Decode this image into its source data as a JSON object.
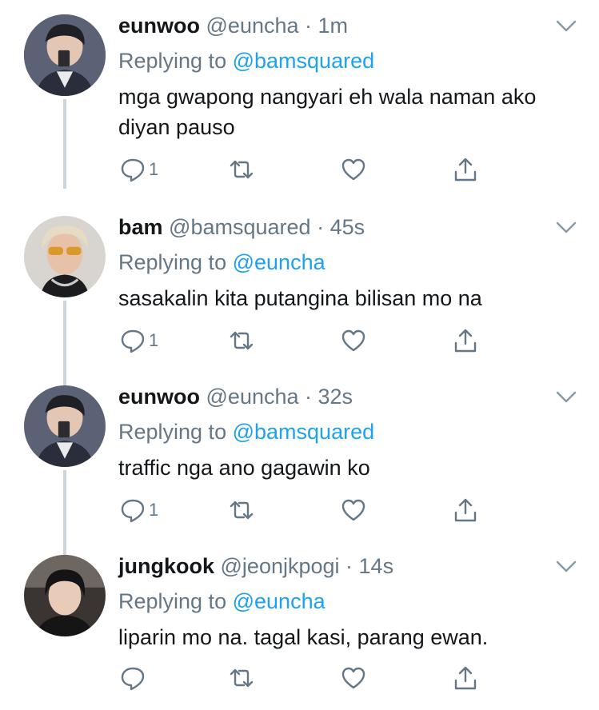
{
  "tweets": [
    {
      "name": "eunwoo",
      "handle": "@euncha",
      "time": "1m",
      "replying_prefix": "Replying to",
      "replying_to": "@bamsquared",
      "text": "mga gwapong nangyari eh wala naman ako diyan pauso",
      "reply_count": "1",
      "avatar": "avatar-mirror-selfie"
    },
    {
      "name": "bam",
      "handle": "@bamsquared",
      "time": "45s",
      "replying_prefix": "Replying to",
      "replying_to": "@euncha",
      "text": "sasakalin kita putangina bilisan mo na",
      "reply_count": "1",
      "avatar": "avatar-blond-sunglasses"
    },
    {
      "name": "eunwoo",
      "handle": "@euncha",
      "time": "32s",
      "replying_prefix": "Replying to",
      "replying_to": "@bamsquared",
      "text": "traffic nga ano gagawin ko",
      "reply_count": "1",
      "avatar": "avatar-mirror-selfie"
    },
    {
      "name": "jungkook",
      "handle": "@jeonjkpogi",
      "time": "14s",
      "replying_prefix": "Replying to",
      "replying_to": "@euncha",
      "text": "liparin mo na. tagal kasi, parang ewan.",
      "reply_count": "",
      "avatar": "avatar-dark-hair"
    }
  ],
  "colors": {
    "text": "#14171a",
    "secondary": "#657786",
    "link": "#1da1f2",
    "connector": "#ccd6dd"
  },
  "icons": [
    "reply-icon",
    "retweet-icon",
    "like-icon",
    "share-icon",
    "chevron-down-icon"
  ]
}
